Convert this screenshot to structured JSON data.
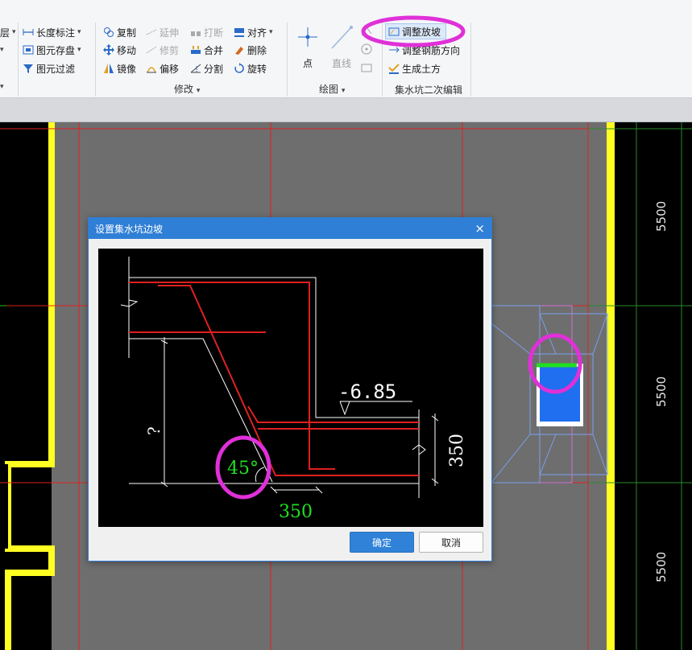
{
  "ribbon": {
    "left_col": {
      "layer_cut": "层",
      "length_label": "长度标注",
      "save_element": "图元存盘",
      "filter_element": "图元过滤"
    },
    "modify": {
      "copy": "复制",
      "extend": "延伸",
      "break": "打断",
      "align": "对齐",
      "move": "移动",
      "trim": "修剪",
      "merge": "合并",
      "delete": "删除",
      "mirror": "镜像",
      "offset": "偏移",
      "split": "分割",
      "rotate": "旋转",
      "group_label": "修改"
    },
    "draw": {
      "point": "点",
      "line": "直线",
      "group_label": "绘图"
    },
    "sump": {
      "adjust_slope": "调整放坡",
      "adjust_rebar_dir": "调整钢筋方向",
      "gen_earthwork": "生成土方",
      "group_label": "集水坑二次编辑"
    }
  },
  "canvas": {
    "dim_labels": [
      "5500",
      "5500",
      "5500"
    ]
  },
  "dialog": {
    "title": "设置集水坑边坡",
    "close_glyph": "×",
    "diagram": {
      "elevation": "-6.85",
      "angle": "45°",
      "bottom_width": "350",
      "right_height": "350",
      "unknown_height": "?"
    },
    "ok_label": "确定",
    "cancel_label": "取消"
  },
  "colors": {
    "highlight_ring": "#e030d8",
    "dialog_title": "#2f7fd6",
    "rebar_red": "#e02020",
    "dim_green": "#20e020",
    "wall_yellow": "#ffff22",
    "pit_blue": "#1f6ff0"
  }
}
